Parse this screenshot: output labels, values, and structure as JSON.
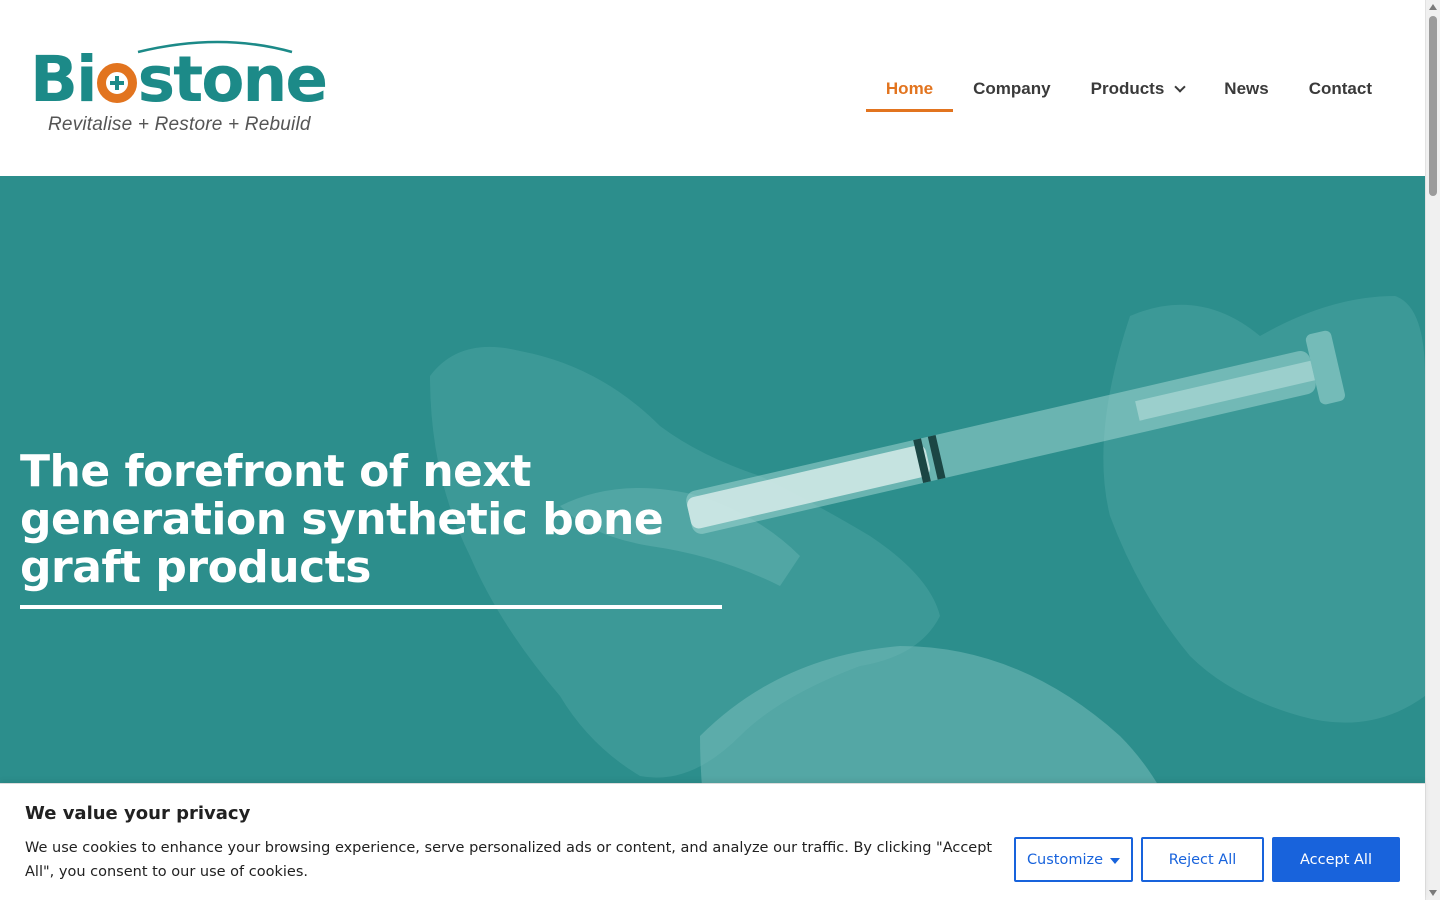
{
  "logo": {
    "part1": "Bi",
    "part2": "stone",
    "tagline": "Revitalise  +   Restore   +  Rebuild",
    "colors": {
      "teal": "#1c8a88",
      "orange": "#e2741f"
    }
  },
  "nav": {
    "items": [
      {
        "label": "Home",
        "active": true
      },
      {
        "label": "Company"
      },
      {
        "label": "Products",
        "has_dropdown": true
      },
      {
        "label": "News"
      },
      {
        "label": "Contact"
      }
    ],
    "active_color": "#e2741f"
  },
  "hero": {
    "title": "The forefront of next generation synthetic bone graft products",
    "background_color": "#2c8e8c"
  },
  "cookie_banner": {
    "title": "We value your privacy",
    "text": "We use cookies to enhance your browsing experience, serve personalized ads or content, and analyze our traffic. By clicking \"Accept All\", you consent to our use of cookies.",
    "buttons": {
      "customize": "Customize",
      "reject": "Reject All",
      "accept": "Accept All"
    },
    "accent_color": "#1863dc"
  }
}
